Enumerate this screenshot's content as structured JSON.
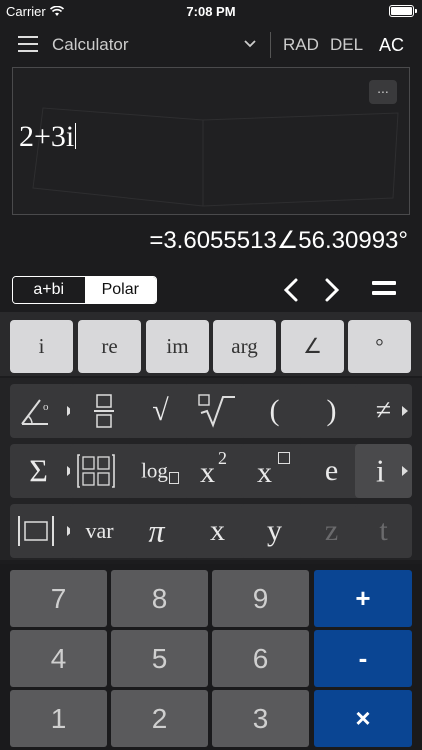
{
  "status": {
    "carrier": "Carrier",
    "time": "7:08 PM"
  },
  "topbar": {
    "title": "Calculator",
    "rad": "RAD",
    "del": "DEL",
    "ac": "AC"
  },
  "display": {
    "more": "...",
    "expression": "2+3i",
    "result": "=3.6055513∠56.30993°"
  },
  "mode": {
    "rect": "a+bi",
    "polar": "Polar",
    "selected": "Polar"
  },
  "complex_keys": [
    "i",
    "re",
    "im",
    "arg",
    "∠",
    "°"
  ],
  "fn_keys": {
    "row1": [
      "angle-icon",
      "fraction-icon",
      "√",
      "nth-root-icon",
      "(",
      ")",
      "≠"
    ],
    "row2": [
      "Σ",
      "matrix-icon",
      "log",
      "x",
      "2",
      "x",
      "power-box-icon",
      "e",
      "i"
    ],
    "row3": [
      "abs-icon",
      "var",
      "π",
      "x",
      "y",
      "z",
      "t"
    ]
  },
  "numpad": {
    "r1": [
      "7",
      "8",
      "9",
      "+"
    ],
    "r2": [
      "4",
      "5",
      "6",
      "-"
    ],
    "r3": [
      "1",
      "2",
      "3",
      "×"
    ]
  },
  "colors": {
    "operator": "#0a4593",
    "number_key": "#5a5a5c",
    "function_key": "#38383a"
  }
}
